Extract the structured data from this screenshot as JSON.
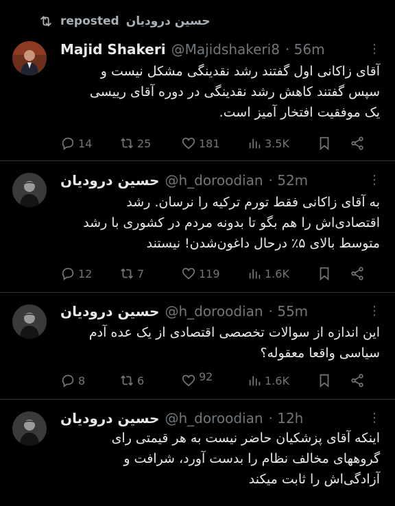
{
  "repost": {
    "label": "reposted",
    "user": "حسین درودیان"
  },
  "tweets": [
    {
      "name": "Majid Shakeri",
      "handle": "@Majidshakeri8",
      "time": "· 56m",
      "lines": [
        "آقای زاکانی اول گفتند رشد نقدینگی مشکل نیست و",
        "سپس گفتند کاهش رشد نقدینگی در دوره آقای رییسی",
        "یک موفقیت افتخار آمیز است."
      ],
      "replies": "14",
      "reposts": "25",
      "likes": "181",
      "views": "3.5K"
    },
    {
      "name": "حسین درودیان",
      "handle": "@h_doroodian",
      "time": "· 52m",
      "lines": [
        "به آقای زاکانی فقط تورم ترکیه را نرسان. رشد",
        "اقتصادی‌اش را هم بگو تا بدونه مردم در کشوری با رشد",
        "متوسط بالای ۵٪ درحال داغون‌شدن! نیستند"
      ],
      "replies": "12",
      "reposts": "7",
      "likes": "119",
      "views": "1.6K"
    },
    {
      "name": "حسین درودیان",
      "handle": "@h_doroodian",
      "time": "· 55m",
      "lines": [
        "این اندازه از سوالات تخصصی اقتصادی از یک عده آدم",
        "سیاسی واقعا معقوله؟"
      ],
      "replies": "8",
      "reposts": "6",
      "likes": "92",
      "views": "1.6K"
    },
    {
      "name": "حسین درودیان",
      "handle": "@h_doroodian",
      "time": "· 12h",
      "lines": [
        "اینکه آقای پزشکیان حاضر نیست به هر قیمتی رای",
        "گروههای مخالف نظام را بدست آورد، شرافت و",
        "آزادگی‌اش را ثابت میکند"
      ]
    }
  ],
  "icons": {
    "repost": "repost-icon",
    "reply": "reply-icon",
    "like": "heart-icon",
    "views": "views-icon",
    "bookmark": "bookmark-icon",
    "share": "share-icon",
    "more": "more-icon"
  },
  "colors": {
    "background": "#000000",
    "text": "#e7e9ea",
    "muted": "#71767b",
    "divider": "#2f3336"
  }
}
